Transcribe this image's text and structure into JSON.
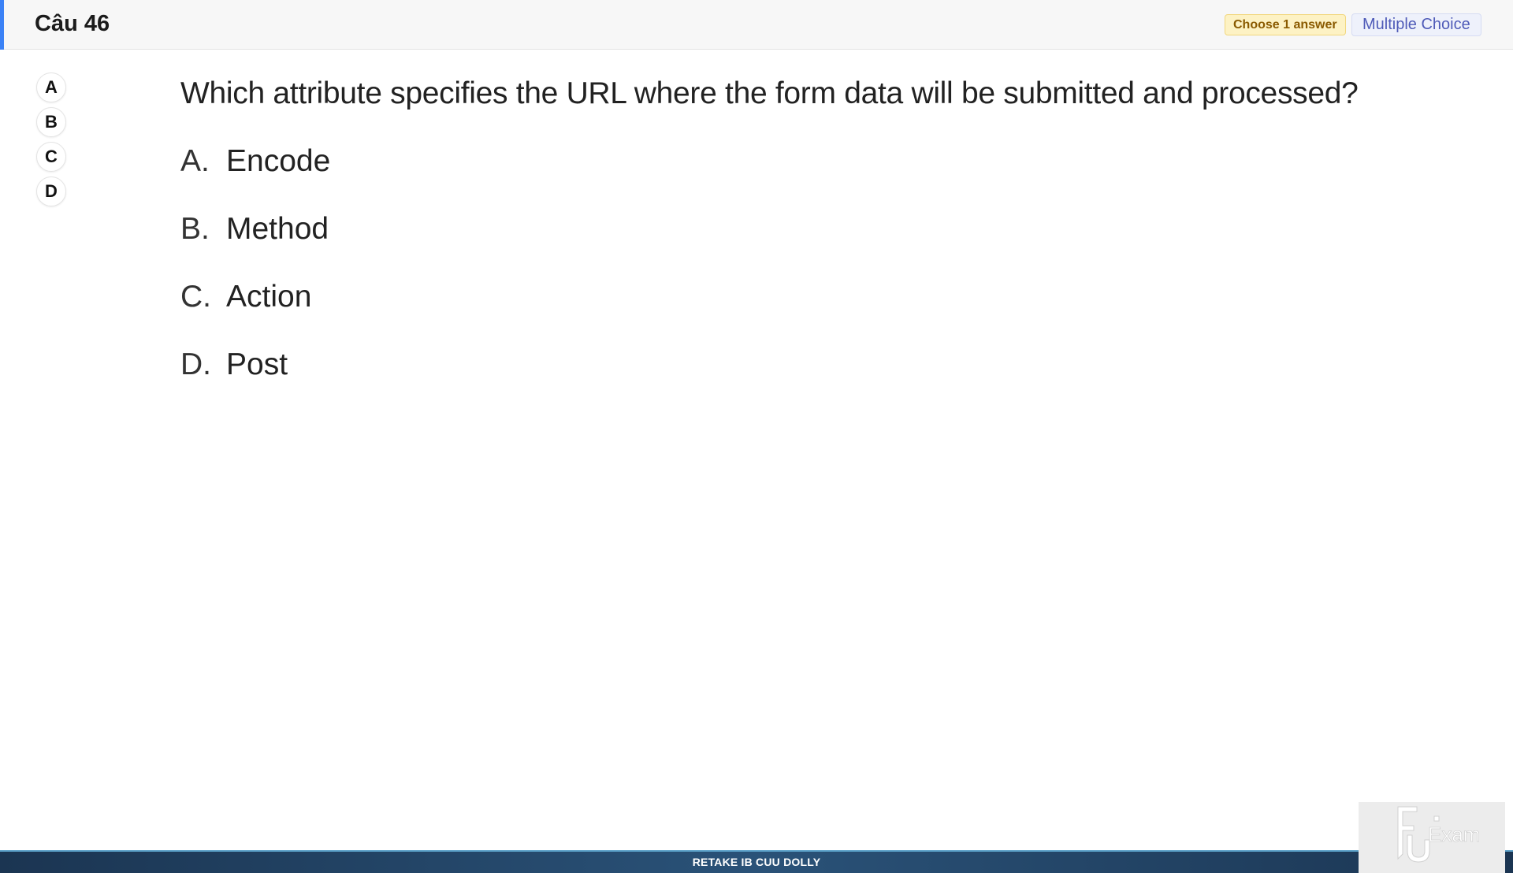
{
  "header": {
    "question_number": "Câu 46",
    "badge_choose": "Choose 1 answer",
    "badge_type": "Multiple Choice",
    "accent_color": "#3b82f6"
  },
  "answer_selector": {
    "items": [
      "A",
      "B",
      "C",
      "D"
    ]
  },
  "question": {
    "text": "Which attribute specifies the URL where the form data will be submitted and processed?",
    "options": [
      {
        "letter": "A.",
        "text": "Encode"
      },
      {
        "letter": "B.",
        "text": "Method"
      },
      {
        "letter": "C.",
        "text": "Action"
      },
      {
        "letter": "D.",
        "text": "Post"
      }
    ]
  },
  "footer": {
    "text": "RETAKE IB CUU DOLLY"
  },
  "logo": {
    "text": "FU Exam",
    "icon": "fu-exam-logo"
  }
}
